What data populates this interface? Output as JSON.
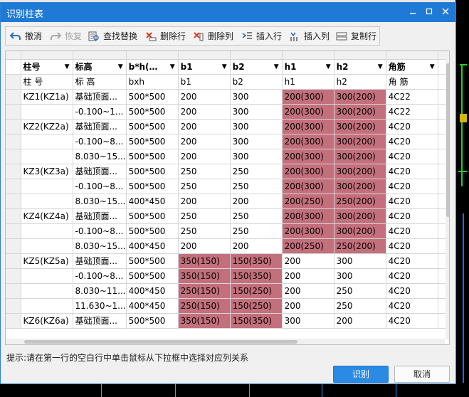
{
  "dialog": {
    "title": "识别柱表",
    "toolbar": {
      "undo": "撤消",
      "redo": "恢复",
      "find_replace": "查找替换",
      "delete_row": "删除行",
      "delete_col": "删除列",
      "insert_row": "插入行",
      "insert_col": "插入列",
      "copy_row": "复制行"
    },
    "grid": {
      "columns": [
        "柱号",
        "标高",
        "b*h(…",
        "b1",
        "b2",
        "h1",
        "h2",
        "角筋"
      ],
      "subheaders": [
        "柱 号",
        "标 高",
        "bxh",
        "b1",
        "b2",
        "h1",
        "h2",
        "角 筋"
      ],
      "rows": [
        [
          "KZ1(KZ1a)",
          "基础顶面...",
          "500*500",
          "200",
          "300",
          "200(300)",
          "300(200)",
          "4C22"
        ],
        [
          "",
          "-0.100~1...",
          "500*500",
          "200",
          "300",
          "200(300)",
          "300(200)",
          "4C22"
        ],
        [
          "KZ2(KZ2a)",
          "基础顶面...",
          "500*500",
          "200",
          "300",
          "200(300)",
          "300(200)",
          "4C20"
        ],
        [
          "",
          "-0.100~8...",
          "500*500",
          "200",
          "300",
          "200(300)",
          "300(200)",
          "4C20"
        ],
        [
          "",
          "8.030~15...",
          "500*500",
          "200",
          "300",
          "200(300)",
          "300(200)",
          "4C20"
        ],
        [
          "KZ3(KZ3a)",
          "基础顶面...",
          "500*500",
          "250",
          "250",
          "200(300)",
          "300(200)",
          "4C20"
        ],
        [
          "",
          "-0.100~8...",
          "500*500",
          "250",
          "250",
          "200(300)",
          "300(200)",
          "4C20"
        ],
        [
          "",
          "8.030~15...",
          "400*450",
          "200",
          "200",
          "200(250)",
          "250(200)",
          "4C20"
        ],
        [
          "KZ4(KZ4a)",
          "基础顶面...",
          "500*500",
          "250",
          "250",
          "200(300)",
          "300(200)",
          "4C20"
        ],
        [
          "",
          "-0.100~8...",
          "500*500",
          "250",
          "250",
          "200(300)",
          "300(200)",
          "4C20"
        ],
        [
          "",
          "8.030~15...",
          "400*450",
          "200",
          "200",
          "200(250)",
          "250(200)",
          "4C20"
        ],
        [
          "KZ5(KZ5a)",
          "基础顶面...",
          "500*500",
          "350(150)",
          "150(350)",
          "200",
          "300",
          "4C20"
        ],
        [
          "",
          "-0.100~8...",
          "500*500",
          "350(150)",
          "150(350)",
          "200",
          "300",
          "4C20"
        ],
        [
          "",
          "8.030~11...",
          "400*450",
          "250(150)",
          "150(250)",
          "200",
          "250",
          "4C20"
        ],
        [
          "",
          "11.630~1...",
          "400*450",
          "250(150)",
          "150(250)",
          "200",
          "250",
          "4C20"
        ],
        [
          "KZ6(KZ6a)",
          "基础顶面...",
          "500*500",
          "350(150)",
          "150(350)",
          "300",
          "200",
          "4C20"
        ]
      ]
    },
    "hint": "提示:请在第一行的空白行中单击鼠标从下拉框中选择对应列关系",
    "buttons": {
      "ok": "识别",
      "cancel": "取消"
    }
  },
  "colors": {
    "highlight": "#c46f7c",
    "titlebar": "#1f7ad6",
    "primary_button": "#2b8ae3"
  }
}
